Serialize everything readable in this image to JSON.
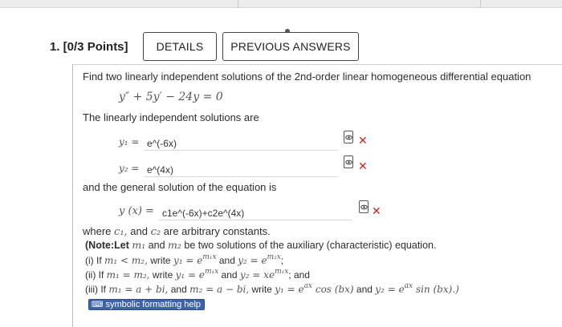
{
  "question": {
    "number_label": "1. [0/3 Points]",
    "details_button": "DETAILS",
    "previous_answers_button": "PREVIOUS ANSWERS"
  },
  "problem": {
    "prompt": "Find two linearly independent solutions of the 2nd-order linear homogeneous differential equation",
    "equation": "y″ + 5y′ − 24y = 0",
    "solutions_label": "The linearly independent solutions are",
    "y1_label": "y₁ =",
    "y1_value": "e^(-6x)",
    "y2_label": "y₂ =",
    "y2_value": "e^(4x)",
    "general_label": "and the general solution of the equation is",
    "general_lhs": "y (x) =",
    "general_value": "c1e^(-6x)+c2e^(4x)",
    "where_prefix": "where",
    "where_c1": "c₁,",
    "where_and": "and",
    "where_c2": "c₂",
    "where_suffix": "are arbitrary constants."
  },
  "note": {
    "line1_a": "(Note:Let",
    "line1_m1": "m₁",
    "line1_b": "and",
    "line1_m2": "m₂",
    "line1_c": "be two solutions of the auxiliary (characteristic) equation.",
    "line2_a": "(i) If",
    "line2_cond": "m₁ < m₂,",
    "line2_b": "write",
    "line2_y1": "y₁ = e",
    "line2_y1_exp": "m₁x",
    "line2_c": "and",
    "line2_y2": "y₂ = e",
    "line2_y2_exp": "m₂x",
    "line2_d": ";",
    "line3_a": "(ii) If",
    "line3_cond": "m₁ = m₂,",
    "line3_b": "write",
    "line3_y1": "y₁ = e",
    "line3_y1_exp": "m₁x",
    "line3_c": "and",
    "line3_y2": "y₂ = xe",
    "line3_y2_exp": "m₁x",
    "line3_d": "; and",
    "line4_a": "(iii) If",
    "line4_m1": "m₁ = a + bi,",
    "line4_b": "and",
    "line4_m2": "m₂ = a − bi,",
    "line4_c": "write",
    "line4_y1": "y₁ = e",
    "line4_y1_exp": "ax",
    "line4_y1_trig": "cos (bx)",
    "line4_d": "and",
    "line4_y2": "y₂ = e",
    "line4_y2_exp": "ax",
    "line4_y2_trig": "sin (bx).)"
  },
  "help": {
    "label": "symbolic formatting help",
    "icon": "keyboard-icon"
  },
  "colors": {
    "incorrect": "#cc2222",
    "help_bg": "#3d63a8"
  }
}
